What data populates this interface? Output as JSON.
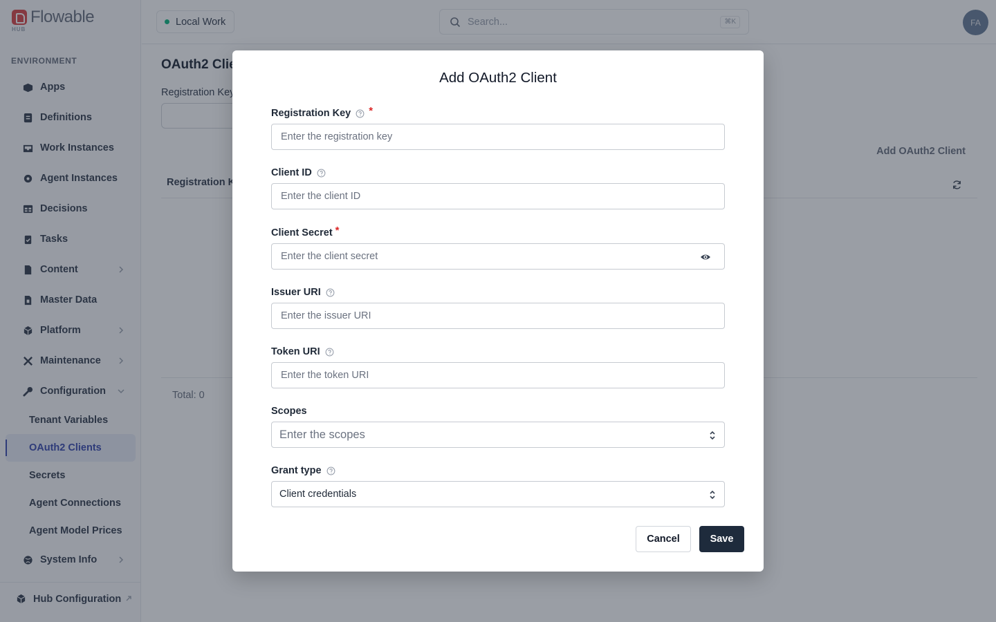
{
  "brand": {
    "name": "Flowable",
    "sub": "HUB"
  },
  "sidebar": {
    "section_label": "ENVIRONMENT",
    "items": [
      {
        "label": "Apps",
        "icon": "apps-icon"
      },
      {
        "label": "Definitions",
        "icon": "definitions-icon"
      },
      {
        "label": "Work Instances",
        "icon": "inbox-icon"
      },
      {
        "label": "Agent Instances",
        "icon": "agent-icon"
      },
      {
        "label": "Decisions",
        "icon": "table-icon"
      },
      {
        "label": "Tasks",
        "icon": "clipboard-icon"
      },
      {
        "label": "Content",
        "icon": "file-icon",
        "expandable": true
      },
      {
        "label": "Master Data",
        "icon": "database-icon"
      },
      {
        "label": "Platform",
        "icon": "cube-icon",
        "expandable": true
      },
      {
        "label": "Maintenance",
        "icon": "tools-icon",
        "expandable": true
      },
      {
        "label": "Configuration",
        "icon": "wrench-icon",
        "expanded": true
      }
    ],
    "sub_items": [
      {
        "label": "Tenant Variables"
      },
      {
        "label": "OAuth2 Clients",
        "active": true
      },
      {
        "label": "Secrets"
      },
      {
        "label": "Agent Connections"
      },
      {
        "label": "Agent Model Prices"
      }
    ],
    "system_info": "System Info",
    "hub_configuration": "Hub Configuration"
  },
  "topbar": {
    "workspace": "Local Work",
    "search_placeholder": "Search...",
    "search_shortcut": "⌘K",
    "avatar_initials": "FA"
  },
  "page": {
    "title": "OAuth2 Clie",
    "filter_label": "Registration Key",
    "add_button": "Add OAuth2 Client",
    "table_header": "Registration K",
    "total": "Total: 0"
  },
  "modal": {
    "title": "Add OAuth2 Client",
    "fields": {
      "registration_key": {
        "label": "Registration Key",
        "placeholder": "Enter the registration key"
      },
      "client_id": {
        "label": "Client ID",
        "placeholder": "Enter the client ID"
      },
      "client_secret": {
        "label": "Client Secret",
        "placeholder": "Enter the client secret"
      },
      "issuer_uri": {
        "label": "Issuer URI",
        "placeholder": "Enter the issuer URI"
      },
      "token_uri": {
        "label": "Token URI",
        "placeholder": "Enter the token URI"
      },
      "scopes": {
        "label": "Scopes",
        "placeholder": "Enter the scopes"
      },
      "grant_type": {
        "label": "Grant type",
        "value": "Client credentials"
      }
    },
    "required_mark": "*",
    "cancel_label": "Cancel",
    "save_label": "Save"
  },
  "colors": {
    "accent": "#3b4bb0",
    "primary_button": "#1e2b3c",
    "required": "#dc2626",
    "status_dot": "#10b981",
    "brand_mark": "#d9484a"
  }
}
